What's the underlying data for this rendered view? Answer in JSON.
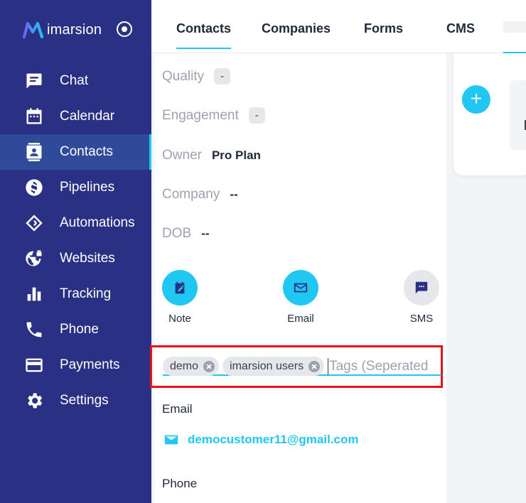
{
  "brand": {
    "name": "imarsion"
  },
  "sidebar": {
    "items": [
      {
        "label": "Chat",
        "icon": "chat-icon"
      },
      {
        "label": "Calendar",
        "icon": "calendar-icon"
      },
      {
        "label": "Contacts",
        "icon": "contacts-icon",
        "active": true
      },
      {
        "label": "Pipelines",
        "icon": "dollar-icon"
      },
      {
        "label": "Automations",
        "icon": "automation-icon"
      },
      {
        "label": "Websites",
        "icon": "globe-icon"
      },
      {
        "label": "Tracking",
        "icon": "bar-chart-icon"
      },
      {
        "label": "Phone",
        "icon": "phone-icon"
      },
      {
        "label": "Payments",
        "icon": "credit-card-icon"
      },
      {
        "label": "Settings",
        "icon": "gear-icon"
      }
    ]
  },
  "tabs": [
    {
      "label": "Contacts",
      "active": true
    },
    {
      "label": "Companies"
    },
    {
      "label": "Forms"
    },
    {
      "label": "CMS"
    }
  ],
  "contact": {
    "quality": {
      "label": "Quality",
      "value": "-"
    },
    "engagement": {
      "label": "Engagement",
      "value": "-"
    },
    "owner": {
      "label": "Owner",
      "value": "Pro Plan"
    },
    "company": {
      "label": "Company",
      "value": "--"
    },
    "dob": {
      "label": "DOB",
      "value": "--"
    }
  },
  "actions": [
    {
      "label": "Note",
      "icon": "note-edit-icon",
      "color": "#1fc7f2"
    },
    {
      "label": "Email",
      "icon": "envelope-icon",
      "color": "#1fc7f2"
    },
    {
      "label": "SMS",
      "icon": "message-icon",
      "color": "#e5e7eb"
    }
  ],
  "tags": {
    "items": [
      "demo",
      "imarsion users"
    ],
    "placeholder": "Tags (Seperated"
  },
  "email_section": {
    "label": "Email",
    "value": "democustomer11@gmail.com"
  },
  "phone_section": {
    "label": "Phone"
  },
  "colors": {
    "sidebar": "#2a3185",
    "accent": "#1fc7f2",
    "highlight": "#e0141a"
  }
}
